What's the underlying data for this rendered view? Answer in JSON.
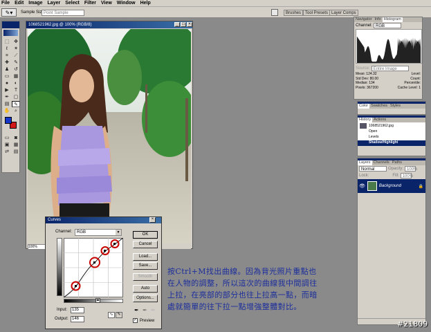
{
  "menu": [
    "File",
    "Edit",
    "Image",
    "Layer",
    "Select",
    "Filter",
    "View",
    "Window",
    "Help"
  ],
  "options": {
    "sample_size_label": "Sample Size:",
    "sample_size_value": "Point Sample",
    "tabs": [
      "Brushes",
      "Tool Presets",
      "Layer Comps"
    ]
  },
  "document": {
    "title": "1068521962.jpg @ 100% (RGB/8)",
    "zoom": "100%"
  },
  "histogram": {
    "tabs": [
      "Navigator",
      "Info",
      "Histogram"
    ],
    "channel_label": "Channel:",
    "channel_value": "RGB",
    "source_label": "Source:",
    "source_value": "Entire Image",
    "stats_left": [
      {
        "k": "Mean:",
        "v": "124.32"
      },
      {
        "k": "Std Dev:",
        "v": "80.00"
      },
      {
        "k": "Median:",
        "v": "134"
      },
      {
        "k": "Pixels:",
        "v": "367200"
      }
    ],
    "stats_right": [
      {
        "k": "Level:",
        "v": ""
      },
      {
        "k": "Count:",
        "v": ""
      },
      {
        "k": "Percentile:",
        "v": ""
      },
      {
        "k": "Cache Level:",
        "v": "1"
      }
    ]
  },
  "color_panel": {
    "tabs": [
      "Color",
      "Swatches",
      "Styles"
    ]
  },
  "history": {
    "tabs": [
      "History",
      "Actions"
    ],
    "snapshot": "1068521962.jpg",
    "items": [
      "Open",
      "Levels",
      "Shadow/Highlight"
    ],
    "active_index": 2
  },
  "layers": {
    "tabs": [
      "Layers",
      "Channels",
      "Paths"
    ],
    "mode": "Normal",
    "opacity_label": "Opacity:",
    "opacity": "100%",
    "lock_label": "Lock:",
    "fill_label": "Fill:",
    "fill": "100%",
    "layer_name": "Background"
  },
  "curves": {
    "title": "Curves",
    "channel_label": "Channel:",
    "channel_value": "RGB",
    "buttons": {
      "ok": "OK",
      "cancel": "Cancel",
      "load": "Load...",
      "save": "Save...",
      "smooth": "Smooth",
      "auto": "Auto",
      "options": "Options..."
    },
    "input_label": "Input:",
    "input_value": "135",
    "output_label": "Output:",
    "output_value": "146",
    "preview_label": "Preview"
  },
  "note": "按Ctrl+M找出曲線。因為背光照片重點也在人物的調整，所以這次的曲線我中間調往上拉，在亮部的部分也往上拉高一點，而暗處就簡單的往下拉一點增強整體對比。",
  "watermark": "#21809",
  "colors": {
    "titlebar": "#0a246a",
    "note": "#1c2e9c",
    "panel": "#d4d0c8",
    "circle": "#c80000"
  }
}
